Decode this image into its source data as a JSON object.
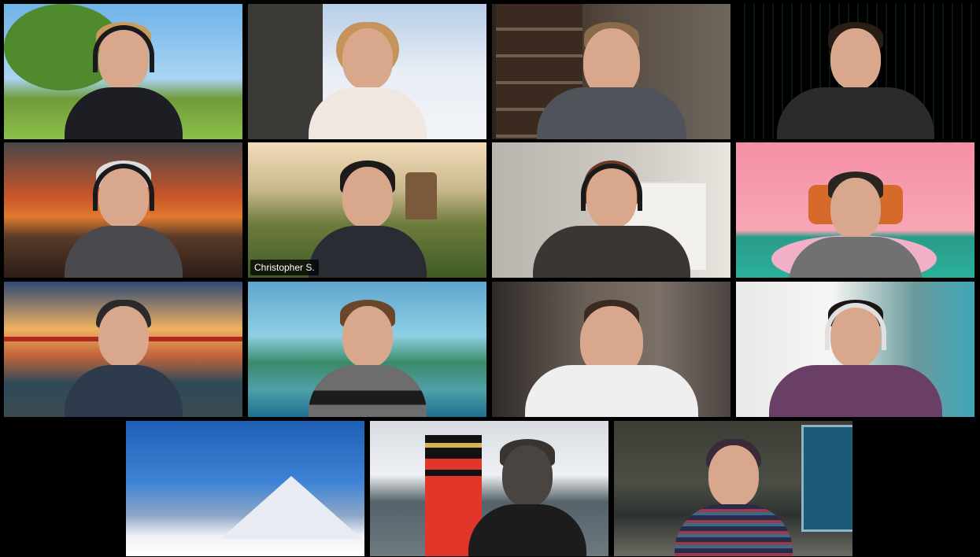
{
  "meeting": {
    "view": "gallery",
    "participants": [
      {
        "id": "p1",
        "label": ""
      },
      {
        "id": "p2",
        "label": ""
      },
      {
        "id": "p3",
        "label": ""
      },
      {
        "id": "p4",
        "label": ""
      },
      {
        "id": "p5",
        "label": ""
      },
      {
        "id": "p6",
        "label": "Christopher S.",
        "active_speaker": true
      },
      {
        "id": "p7",
        "label": ""
      },
      {
        "id": "p8",
        "label": ""
      },
      {
        "id": "p9",
        "label": ""
      },
      {
        "id": "p10",
        "label": ""
      },
      {
        "id": "p11",
        "label": ""
      },
      {
        "id": "p12",
        "label": ""
      },
      {
        "id": "p13",
        "label": ""
      },
      {
        "id": "p14",
        "label": ""
      },
      {
        "id": "p15",
        "label": ""
      }
    ]
  },
  "colors": {
    "active_speaker_border": "#8a8d55",
    "background": "#000000"
  }
}
